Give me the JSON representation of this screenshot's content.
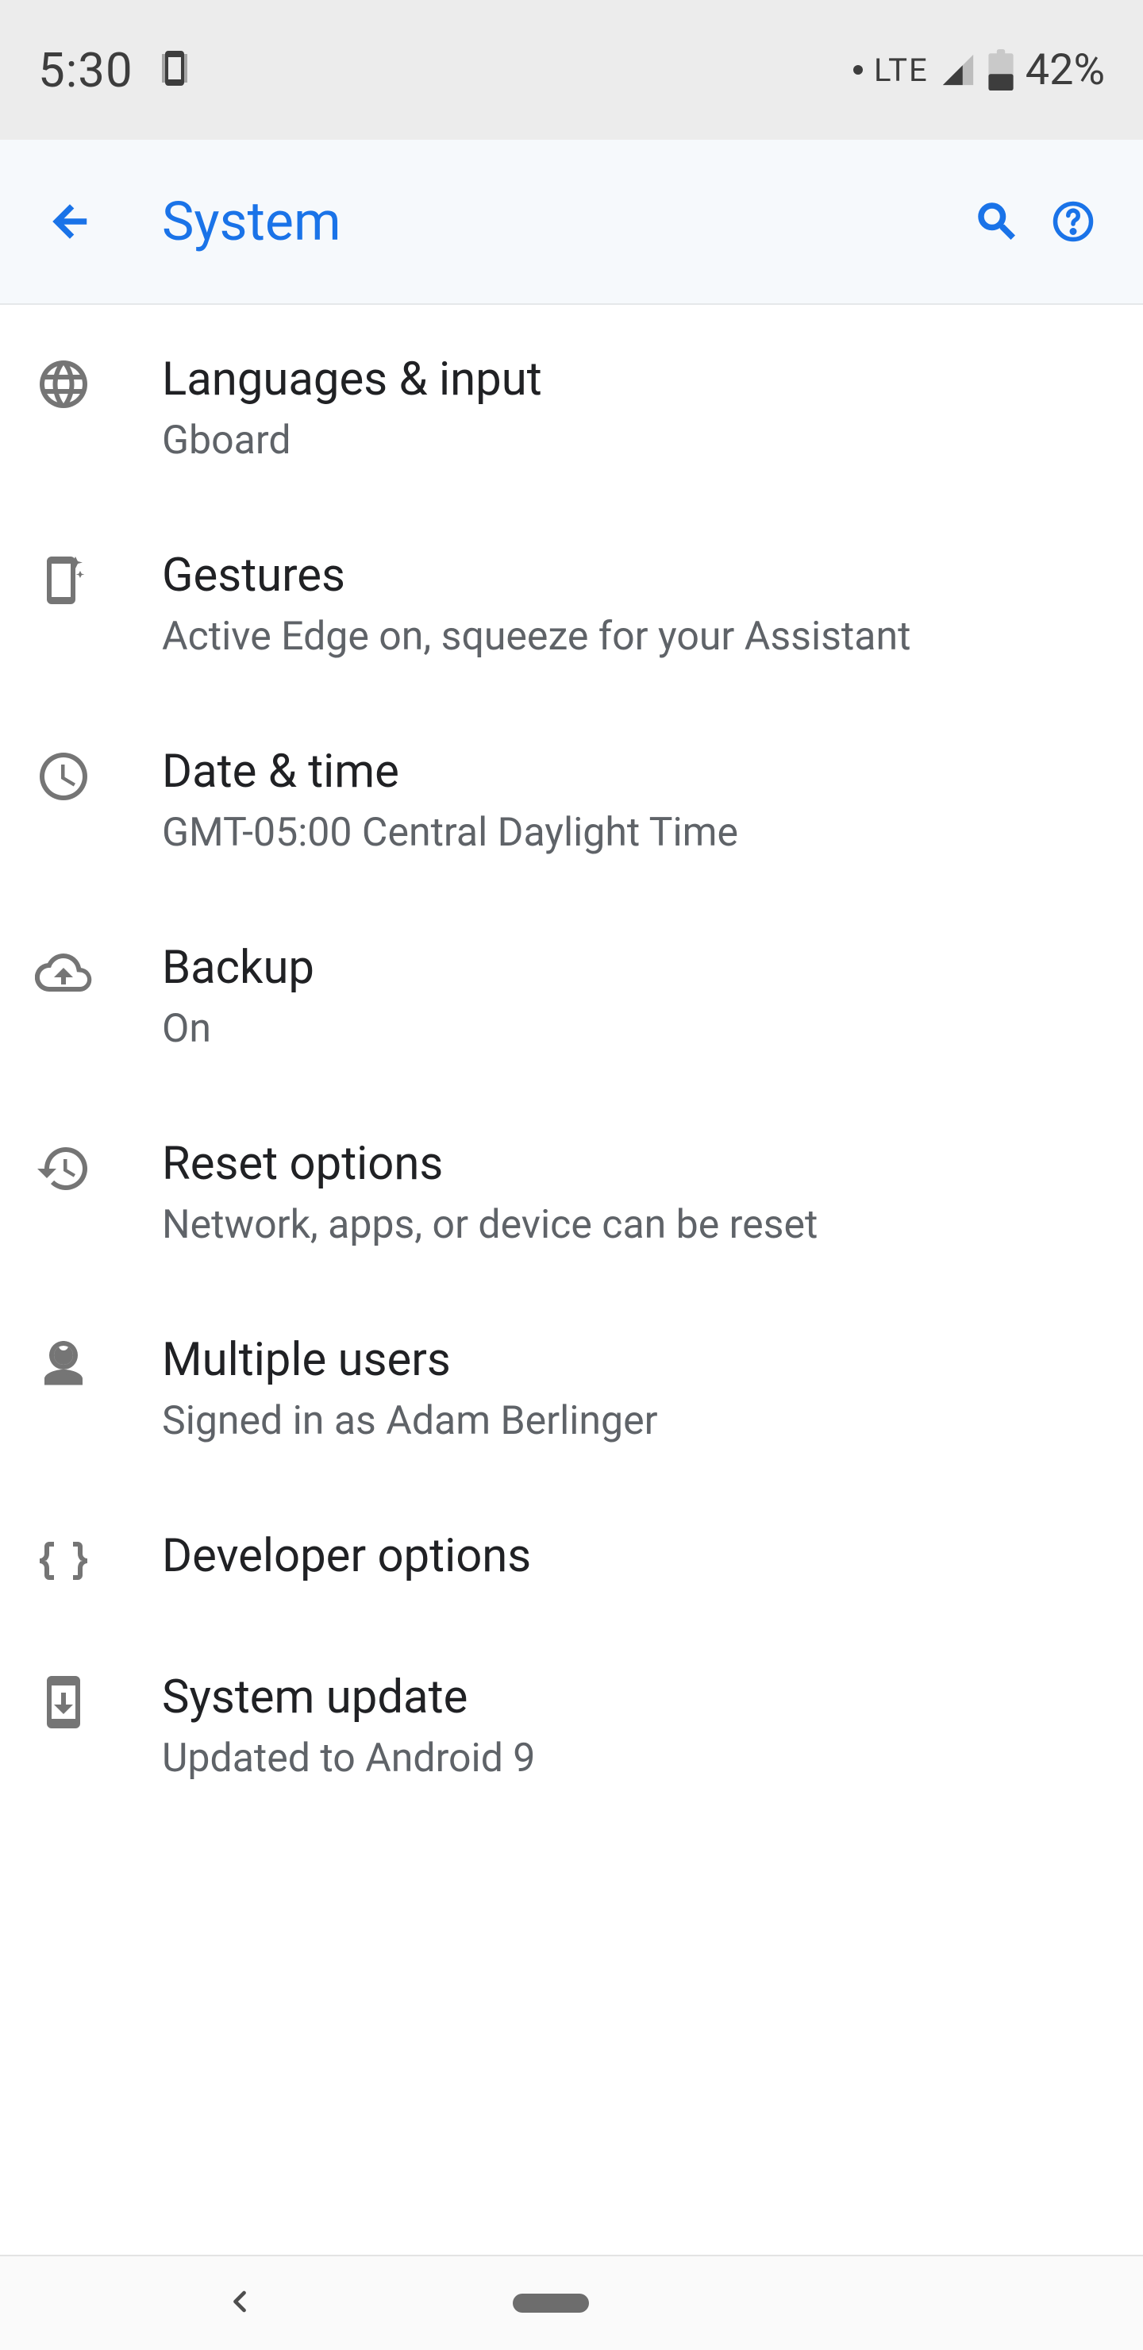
{
  "status": {
    "time": "5:30",
    "network_label": "LTE",
    "battery_pct": "42%"
  },
  "appbar": {
    "title": "System"
  },
  "items": [
    {
      "title": "Languages & input",
      "sub": "Gboard"
    },
    {
      "title": "Gestures",
      "sub": "Active Edge on, squeeze for your Assistant"
    },
    {
      "title": "Date & time",
      "sub": "GMT-05:00 Central Daylight Time"
    },
    {
      "title": "Backup",
      "sub": "On"
    },
    {
      "title": "Reset options",
      "sub": "Network, apps, or device can be reset"
    },
    {
      "title": "Multiple users",
      "sub": "Signed in as Adam Berlinger"
    },
    {
      "title": "Developer options",
      "sub": ""
    },
    {
      "title": "System update",
      "sub": "Updated to Android 9"
    }
  ]
}
